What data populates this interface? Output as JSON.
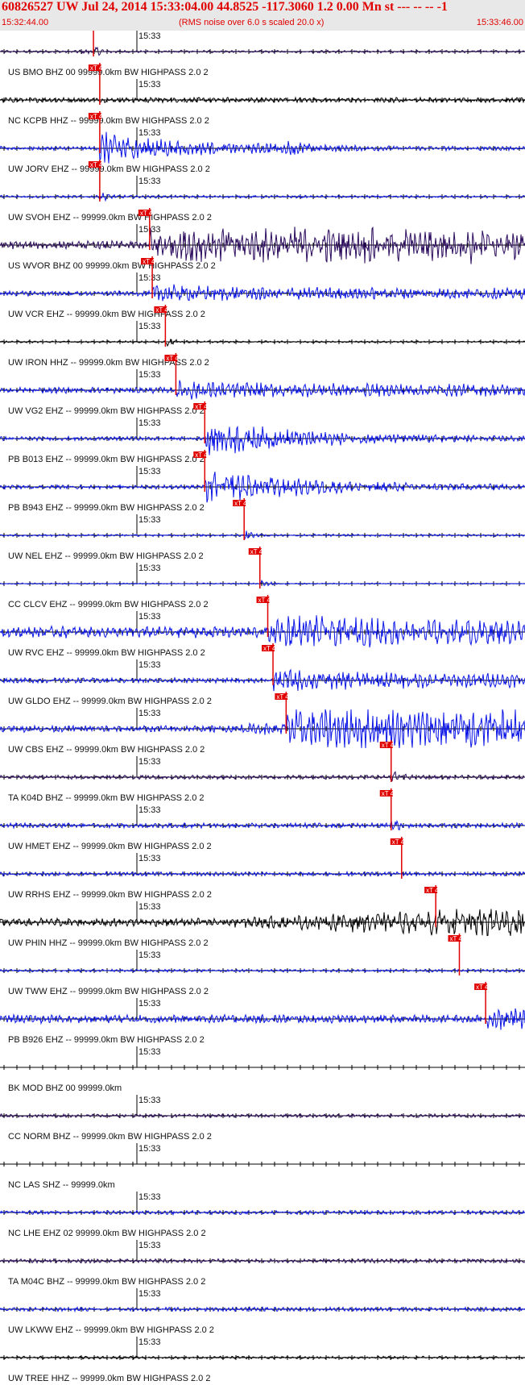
{
  "header": {
    "title": "60826527 UW Jul 24, 2014 15:33:04.00   44.8525 -117.3060  1.2 0.00 Mn st --- -- --  -1",
    "start_time": "15:32:44.00",
    "noise_note": "(RMS noise over 6.0 s scaled 20.0 x)",
    "end_time": "15:33:46.00"
  },
  "minute_label": "15:33",
  "pick_label": "xT 4",
  "colors": {
    "blue": "#0a14e6",
    "black": "#000000",
    "purple": "#2a0a5c",
    "pick": "#e00000"
  },
  "traces": [
    {
      "label": "US BMO BHZ 00 99999.0km BW  HIGHPASS  2.0  2",
      "color": "purple",
      "pick": 0.178,
      "amp": 0.25,
      "noise": 0.08,
      "type": "burst"
    },
    {
      "label": "NC KCPB HHZ -- 99999.0km BW  HIGHPASS  2.0  2",
      "color": "black",
      "pick": 0.19,
      "amp": 0.15,
      "noise": 0.15,
      "type": "steady"
    },
    {
      "label": "UW JORV EHZ -- 99999.0km BW  HIGHPASS  2.0  2",
      "color": "blue",
      "pick": 0.19,
      "amp": 0.9,
      "noise": 0.12,
      "type": "strong"
    },
    {
      "label": "UW SVOH EHZ -- 99999.0km BW  HIGHPASS  2.0  2",
      "color": "blue",
      "pick": 0.19,
      "amp": 0.25,
      "noise": 0.08,
      "type": "spike"
    },
    {
      "label": "US WVOR BHZ 00 99999.0km BW  HIGHPASS  2.0  2",
      "color": "purple",
      "pick": 0.285,
      "amp": 0.9,
      "noise": 0.25,
      "type": "bursty"
    },
    {
      "label": "UW VCR EHZ -- 99999.0km BW  HIGHPASS  2.0  2",
      "color": "blue",
      "pick": 0.29,
      "amp": 0.45,
      "noise": 0.15,
      "type": "moderate"
    },
    {
      "label": "UW IRON HHZ -- 99999.0km BW  HIGHPASS  2.0  2",
      "color": "black",
      "pick": 0.315,
      "amp": 0.25,
      "noise": 0.06,
      "type": "spike"
    },
    {
      "label": "UW VG2 EHZ -- 99999.0km BW  HIGHPASS  2.0  2",
      "color": "blue",
      "pick": 0.335,
      "amp": 0.45,
      "noise": 0.18,
      "type": "moderate"
    },
    {
      "label": "PB B013 EHZ -- 99999.0km BW  HIGHPASS  2.0  2",
      "color": "blue",
      "pick": 0.39,
      "amp": 1.0,
      "noise": 0.12,
      "type": "decay"
    },
    {
      "label": "PB B943 EHZ -- 99999.0km BW  HIGHPASS  2.0  2",
      "color": "blue",
      "pick": 0.39,
      "amp": 1.0,
      "noise": 0.12,
      "type": "decay"
    },
    {
      "label": "UW NEL EHZ -- 99999.0km BW  HIGHPASS  2.0  2",
      "color": "blue",
      "pick": 0.465,
      "amp": 0.35,
      "noise": 0.07,
      "type": "spike"
    },
    {
      "label": "CC CLCV EHZ -- 99999.0km BW  HIGHPASS  2.0  2",
      "color": "blue",
      "pick": 0.495,
      "amp": 0.25,
      "noise": 0.04,
      "type": "spike"
    },
    {
      "label": "UW RVC EHZ -- 99999.0km BW  HIGHPASS  2.0  2",
      "color": "blue",
      "pick": 0.51,
      "amp": 0.85,
      "noise": 0.35,
      "type": "moderate"
    },
    {
      "label": "UW GLDO EHZ -- 99999.0km BW  HIGHPASS  2.0  2",
      "color": "blue",
      "pick": 0.52,
      "amp": 0.6,
      "noise": 0.15,
      "type": "moderate"
    },
    {
      "label": "UW CBS EHZ -- 99999.0km BW  HIGHPASS  2.0  2",
      "color": "blue",
      "pick": 0.545,
      "amp": 1.0,
      "noise": 0.2,
      "type": "saturate"
    },
    {
      "label": "TA K04D BHZ -- 99999.0km BW  HIGHPASS  2.0  2",
      "color": "purple",
      "pick": 0.745,
      "amp": 0.35,
      "noise": 0.12,
      "type": "spike"
    },
    {
      "label": "UW HMET EHZ -- 99999.0km BW  HIGHPASS  2.0  2",
      "color": "blue",
      "pick": 0.745,
      "amp": 0.35,
      "noise": 0.15,
      "type": "spike"
    },
    {
      "label": "UW RRHS EHZ -- 99999.0km BW  HIGHPASS  2.0  2",
      "color": "blue",
      "pick": 0.765,
      "amp": 0.15,
      "noise": 0.12,
      "type": "steady"
    },
    {
      "label": "UW PHIN HHZ -- 99999.0km BW  HIGHPASS  2.0  2",
      "color": "black",
      "pick": 0.83,
      "amp": 0.7,
      "noise": 0.25,
      "type": "ramp"
    },
    {
      "label": "UW TWW EHZ -- 99999.0km BW  HIGHPASS  2.0  2",
      "color": "blue",
      "pick": 0.875,
      "amp": 0.2,
      "noise": 0.08,
      "type": "steady"
    },
    {
      "label": "PB B926 EHZ -- 99999.0km BW  HIGHPASS  2.0  2",
      "color": "blue",
      "pick": 0.925,
      "amp": 0.45,
      "noise": 0.25,
      "type": "bursty"
    },
    {
      "label": "BK MOD BHZ 00 99999.0km",
      "color": "blue",
      "pick": null,
      "amp": 0,
      "noise": 0,
      "type": "flat"
    },
    {
      "label": "CC NORM BHZ -- 99999.0km BW  HIGHPASS  2.0  2",
      "color": "purple",
      "pick": null,
      "amp": 0.1,
      "noise": 0.1,
      "type": "steady"
    },
    {
      "label": "NC LAS SHZ -- 99999.0km",
      "color": "blue",
      "pick": null,
      "amp": 0,
      "noise": 0,
      "type": "flat"
    },
    {
      "label": "NC LHE EHZ 02 99999.0km BW  HIGHPASS  2.0  2",
      "color": "blue",
      "pick": null,
      "amp": 0.12,
      "noise": 0.12,
      "type": "steady"
    },
    {
      "label": "TA M04C BHZ -- 99999.0km BW  HIGHPASS  2.0  2",
      "color": "purple",
      "pick": null,
      "amp": 0.12,
      "noise": 0.12,
      "type": "steady"
    },
    {
      "label": "UW LKWW EHZ -- 99999.0km BW  HIGHPASS  2.0  2",
      "color": "blue",
      "pick": null,
      "amp": 0.12,
      "noise": 0.12,
      "type": "steady"
    },
    {
      "label": "UW TREE HHZ -- 99999.0km BW  HIGHPASS  2.0  2",
      "color": "black",
      "pick": null,
      "amp": 0.08,
      "noise": 0.08,
      "type": "steady"
    }
  ]
}
